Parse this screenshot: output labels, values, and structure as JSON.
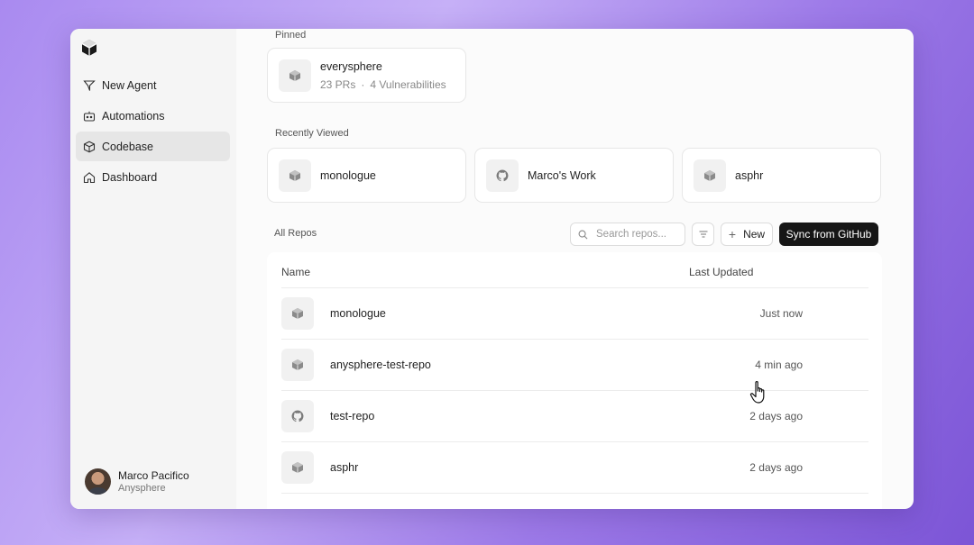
{
  "nav": {
    "items": [
      {
        "label": "New Agent",
        "icon": "send-icon"
      },
      {
        "label": "Automations",
        "icon": "bot-icon"
      },
      {
        "label": "Codebase",
        "icon": "cube-icon",
        "active": true
      },
      {
        "label": "Dashboard",
        "icon": "home-icon"
      }
    ]
  },
  "user": {
    "name": "Marco Pacifico",
    "org": "Anysphere"
  },
  "pinned": {
    "label": "Pinned",
    "card": {
      "name": "everysphere",
      "prs": "23 PRs",
      "vulns": "4 Vulnerabilities"
    }
  },
  "recent": {
    "label": "Recently Viewed",
    "items": [
      {
        "name": "monologue",
        "icon": "cube-icon"
      },
      {
        "name": "Marco's Work",
        "icon": "github-icon"
      },
      {
        "name": "asphr",
        "icon": "cube-icon"
      }
    ]
  },
  "repos": {
    "label": "All Repos",
    "search_placeholder": "Search repos...",
    "new_label": "New",
    "sync_label": "Sync from GitHub",
    "columns": {
      "name": "Name",
      "updated": "Last Updated"
    },
    "rows": [
      {
        "name": "monologue",
        "updated": "Just now",
        "icon": "cube-icon"
      },
      {
        "name": "anysphere-test-repo",
        "updated": "4 min ago",
        "icon": "cube-icon"
      },
      {
        "name": "test-repo",
        "updated": "2 days ago",
        "icon": "github-icon"
      },
      {
        "name": "asphr",
        "updated": "2 days ago",
        "icon": "cube-icon"
      }
    ]
  },
  "colors": {
    "accent": "#161616",
    "background": "#a98af0"
  }
}
